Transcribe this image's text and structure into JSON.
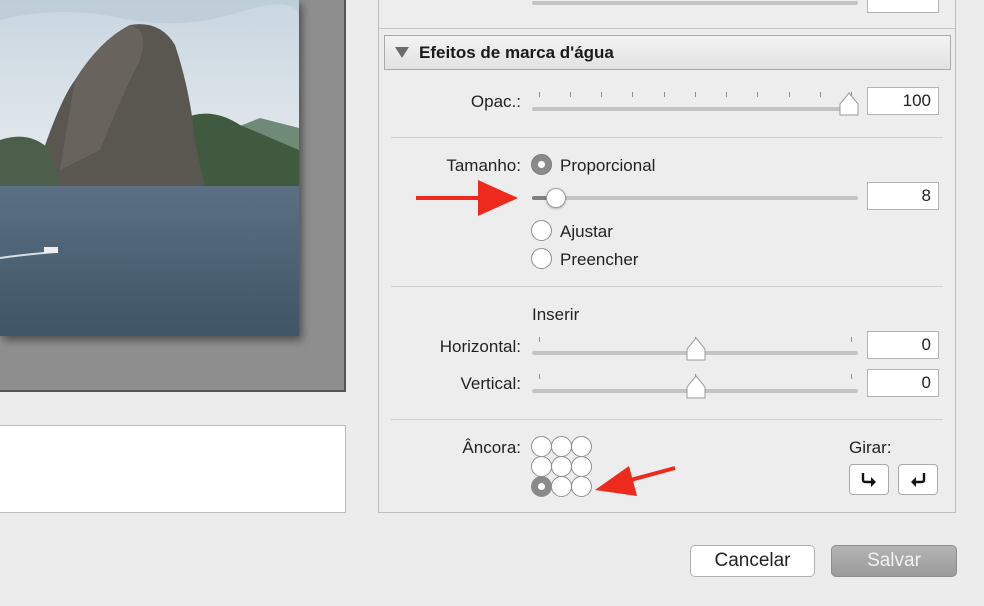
{
  "preview": {
    "photo_alt": "Sugar Loaf mountain over bay"
  },
  "watermark_panel": {
    "section_title": "Efeitos de marca d'água",
    "opacity": {
      "label": "Opac.:",
      "value": "100",
      "level": 1.0
    },
    "size": {
      "label": "Tamanho:",
      "proportional_label": "Proporcional",
      "proportional_selected": true,
      "slider_value": "8",
      "level": 0.08,
      "fit_label": "Ajustar",
      "fill_label": "Preencher"
    },
    "inset": {
      "title": "Inserir",
      "horizontal_label": "Horizontal:",
      "horizontal_value": "0",
      "vertical_label": "Vertical:",
      "vertical_value": "0"
    },
    "anchor": {
      "label": "Âncora:",
      "selected": "bottom-left"
    },
    "rotate": {
      "label": "Girar:",
      "clockwise_icon": "rotate-cw-icon",
      "counterclockwise_icon": "rotate-ccw-icon"
    }
  },
  "footer": {
    "cancel_label": "Cancelar",
    "save_label": "Salvar"
  },
  "colors": {
    "annotation_arrow": "#ee2a1f",
    "save_button": "#a5a5a5"
  }
}
